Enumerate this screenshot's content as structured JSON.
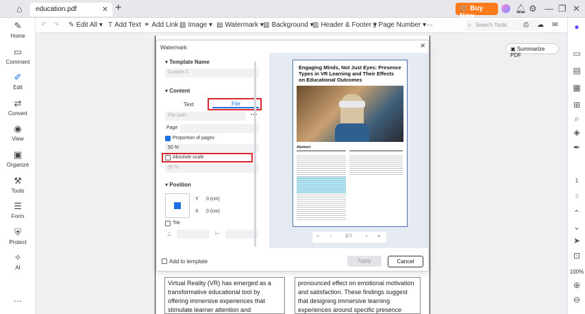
{
  "titlebar": {
    "tab_label": "education.pdf",
    "buy_now": "Buy Now"
  },
  "left_nav": [
    {
      "label": "Home",
      "icon": "home-icon"
    },
    {
      "label": "Comment",
      "icon": "comment-icon"
    },
    {
      "label": "Edit",
      "icon": "edit-icon"
    },
    {
      "label": "Convert",
      "icon": "convert-icon"
    },
    {
      "label": "View",
      "icon": "view-icon"
    },
    {
      "label": "Organize",
      "icon": "organize-icon"
    },
    {
      "label": "Tools",
      "icon": "tools-icon"
    },
    {
      "label": "Form",
      "icon": "form-icon"
    },
    {
      "label": "Protect",
      "icon": "protect-icon"
    },
    {
      "label": "AI",
      "icon": "ai-icon"
    }
  ],
  "toolbar": {
    "edit_all": "Edit All",
    "add_text": "Add Text",
    "add_link": "Add Link",
    "image": "Image",
    "watermark": "Watermark",
    "background": "Background",
    "header_footer": "Header & Footer",
    "page_number": "Page Number",
    "search_placeholder": "Search Tools"
  },
  "summarize": "Summarize PDF",
  "right_bar": {
    "page_current": "1",
    "page_next": "3",
    "zoom": "100%"
  },
  "dialog": {
    "title": "Watermark",
    "template_name_label": "Template Name",
    "template_name_value": "Custom 1",
    "content_label": "Content",
    "tab_text": "Text",
    "tab_file": "File",
    "file_path_placeholder": "File path",
    "page_label": "Page",
    "proportion_label": "Proportion of pages",
    "proportion_value": "50 %",
    "absolute_scale_label": "Absolute scale",
    "absolute_scale_value": "50 %",
    "position_label": "Position",
    "y_label": "Y",
    "y_value": "0 (cm)",
    "x_label": "X",
    "x_value": "0 (cm)",
    "tile_label": "Tile",
    "add_to_template": "Add to template",
    "apply": "Apply",
    "cancel": "Cancel"
  },
  "preview": {
    "doc_title": "Engaging Minds, Not Just Eyes: Presence Types in VR Learning and Their Effects on Educational Outcomes",
    "abstract_label": "Abstract",
    "page_indicator": "1",
    "page_total": "/3"
  },
  "background_text": {
    "left": "Virtual Reality (VR) has emerged as a transformative educational tool by offering immersive experiences that stimulate learner attention and engagement. Central to its",
    "right": "pronounced effect on emotional motivation and satisfaction. These findings suggest that designing immersive learning experiences around specific presence types can enhance targeted educational"
  },
  "colors": {
    "accent": "#1f6fe5",
    "buy_now": "#ff7a1a",
    "highlight": "#d8262e"
  }
}
